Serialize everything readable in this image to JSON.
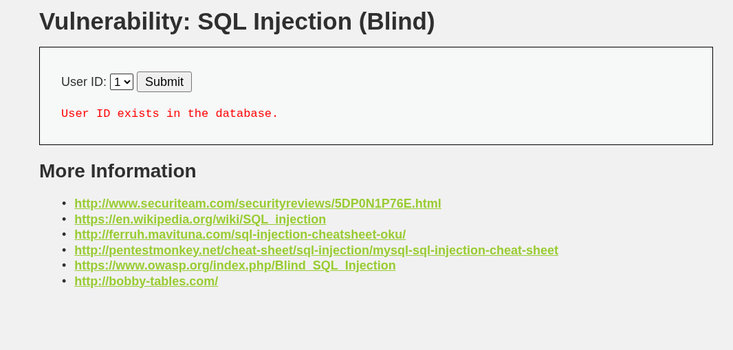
{
  "title": "Vulnerability: SQL Injection (Blind)",
  "form": {
    "label": "User ID:",
    "select_value": "1",
    "submit": "Submit",
    "message": "User ID exists in the database."
  },
  "more_info": {
    "heading": "More Information",
    "links": [
      {
        "bullet": "•",
        "url": "http://www.securiteam.com/securityreviews/5DP0N1P76E.html"
      },
      {
        "bullet": "•",
        "url": "https://en.wikipedia.org/wiki/SQL_injection"
      },
      {
        "bullet": "•",
        "url": "http://ferruh.mavituna.com/sql-injection-cheatsheet-oku/"
      },
      {
        "bullet": "•",
        "url": "http://pentestmonkey.net/cheat-sheet/sql-injection/mysql-sql-injection-cheat-sheet"
      },
      {
        "bullet": "•",
        "url": "https://www.owasp.org/index.php/Blind_SQL_Injection"
      },
      {
        "bullet": "•",
        "url": "http://bobby-tables.com/"
      }
    ]
  }
}
